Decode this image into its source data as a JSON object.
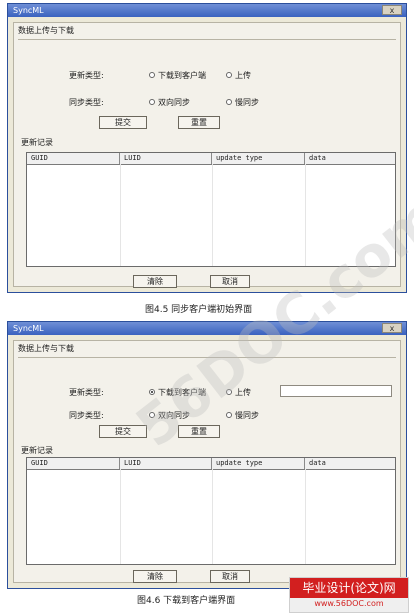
{
  "window1": {
    "title": "SyncML",
    "close": "x",
    "panel_title": "数据上传与下载",
    "update_type_label": "更新类型:",
    "update_opt1": "下载到客户端",
    "update_opt2": "上传",
    "sync_type_label": "同步类型:",
    "sync_opt1": "双向同步",
    "sync_opt2": "慢同步",
    "submit_label": "提交",
    "reset_label": "重置",
    "records_label": "更新记录",
    "cols": [
      "GUID",
      "LUID",
      "update type",
      "data"
    ],
    "clear_label": "清除",
    "cancel_label": "取消",
    "caption": "图4.5  同步客户端初始界面"
  },
  "window2": {
    "title": "SyncML",
    "close": "x",
    "panel_title": "数据上传与下载",
    "update_type_label": "更新类型:",
    "update_opt1": "下载到客户端",
    "update_opt2": "上传",
    "sync_type_label": "同步类型:",
    "sync_opt1": "双向同步",
    "sync_opt2": "慢同步",
    "submit_label": "提交",
    "reset_label": "重置",
    "records_label": "更新记录",
    "cols": [
      "GUID",
      "LUID",
      "update type",
      "data"
    ],
    "clear_label": "清除",
    "cancel_label": "取消",
    "caption": "图4.6  下载到客户端界面"
  },
  "watermark": "56DOC.com",
  "brand": {
    "line1": "毕业设计(论文)网",
    "line2": "www.56DOC.com"
  },
  "colors": {
    "titlebar": "#3a62bf",
    "brand_red": "#d21f1f"
  }
}
